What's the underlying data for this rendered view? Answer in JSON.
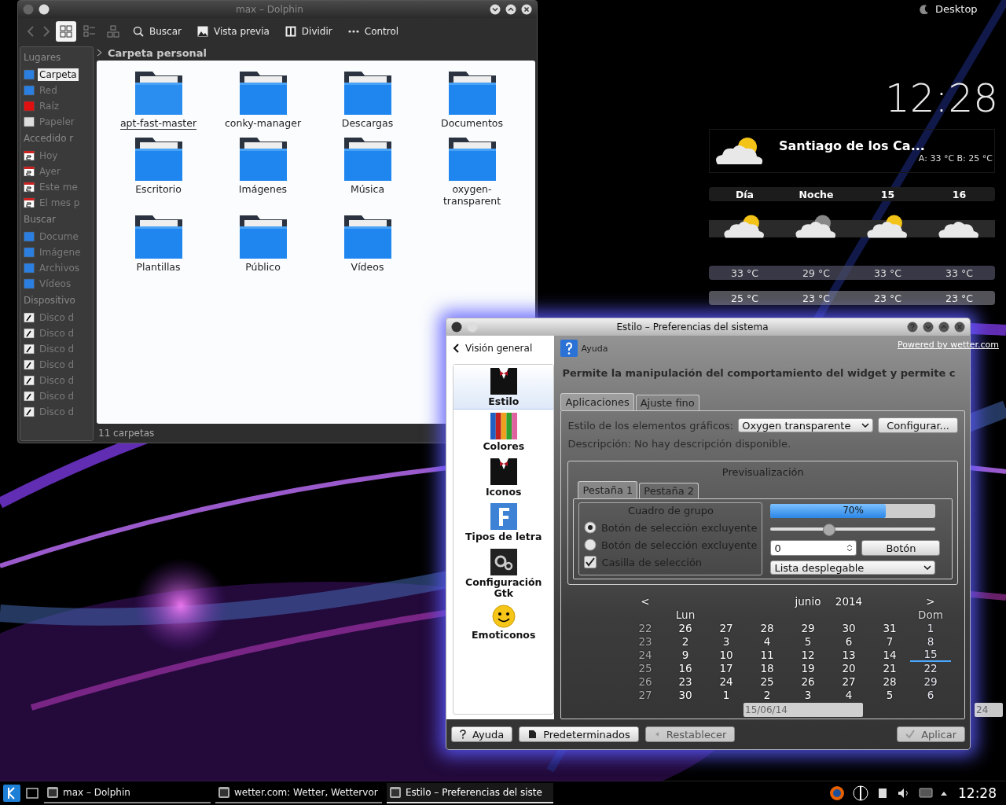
{
  "activity": {
    "label": "Desktop"
  },
  "clock": {
    "time": "12:28"
  },
  "weather": {
    "location": "Santiago de los Ca...",
    "summary": "A: 33 °C B: 25 °C",
    "columns": [
      {
        "label": "Día",
        "kind": "sun",
        "high": "33 °C",
        "low": "25 °C"
      },
      {
        "label": "Noche",
        "kind": "moon",
        "high": "29 °C",
        "low": "23 °C"
      },
      {
        "label": "15",
        "kind": "sun",
        "high": "33 °C",
        "low": "23 °C"
      },
      {
        "label": "16",
        "kind": "cloud",
        "high": "33 °C",
        "low": "23 °C"
      }
    ],
    "credit": "Powered by wetter.com"
  },
  "dolphin": {
    "title": "max – Dolphin",
    "view_modes": [
      {
        "selected": true
      },
      {
        "selected": false
      },
      {
        "selected": false
      }
    ],
    "actions": [
      {
        "kind": "search",
        "label": "Buscar"
      },
      {
        "kind": "preview",
        "label": "Vista previa"
      },
      {
        "kind": "split",
        "label": "Dividir"
      },
      {
        "kind": "menu",
        "label": "Control"
      }
    ],
    "places": [
      {
        "heading": "Lugares",
        "items": [
          {
            "kind": "home",
            "label": "Carpeta",
            "selected": true
          },
          {
            "kind": "network",
            "label": "Red",
            "selected": false
          },
          {
            "kind": "root",
            "label": "Raíz",
            "selected": false
          },
          {
            "kind": "trash",
            "label": "Papeler",
            "selected": false
          }
        ]
      },
      {
        "heading": "Accedido r",
        "items": [
          {
            "kind": "calendar",
            "label": "Hoy",
            "selected": false
          },
          {
            "kind": "calendar",
            "label": "Ayer",
            "selected": false
          },
          {
            "kind": "calendar",
            "label": "Este me",
            "selected": false
          },
          {
            "kind": "calendar",
            "label": "El mes p",
            "selected": false
          }
        ]
      },
      {
        "heading": "Buscar",
        "items": [
          {
            "kind": "document",
            "label": "Docume",
            "selected": false
          },
          {
            "kind": "image",
            "label": "Imágene",
            "selected": false
          },
          {
            "kind": "music",
            "label": "Archivos",
            "selected": false
          },
          {
            "kind": "video",
            "label": "Vídeos",
            "selected": false
          }
        ]
      },
      {
        "heading": "Dispositivo",
        "items": [
          {
            "kind": "disk",
            "label": "Disco d",
            "selected": false
          },
          {
            "kind": "disk",
            "label": "Disco d",
            "selected": false
          },
          {
            "kind": "disk",
            "label": "Disco d",
            "selected": false
          },
          {
            "kind": "disk",
            "label": "Disco d",
            "selected": false
          },
          {
            "kind": "disk",
            "label": "Disco d",
            "selected": false
          },
          {
            "kind": "disk",
            "label": "Disco d",
            "selected": false
          },
          {
            "kind": "disk",
            "label": "Disco d",
            "selected": false
          }
        ]
      }
    ],
    "breadcrumb": "Carpeta personal",
    "folders": [
      {
        "name": "apt-fast-master",
        "selected": true
      },
      {
        "name": "conky-manager",
        "selected": false
      },
      {
        "name": "Descargas",
        "selected": false
      },
      {
        "name": "Documentos",
        "selected": false
      },
      {
        "name": "Escritorio",
        "selected": false
      },
      {
        "name": "Imágenes",
        "selected": false
      },
      {
        "name": "Música",
        "selected": false
      },
      {
        "name": "oxygen-transparent",
        "selected": false
      },
      {
        "name": "Plantillas",
        "selected": false
      },
      {
        "name": "Público",
        "selected": false
      },
      {
        "name": "Vídeos",
        "selected": false
      }
    ],
    "status": "11 carpetas"
  },
  "settings": {
    "title": "Estilo – Preferencias del sistema",
    "back": "Visión general",
    "help": "Ayuda",
    "categories": [
      {
        "kind": "style",
        "label": "Estilo",
        "selected": true
      },
      {
        "kind": "colors",
        "label": "Colores",
        "selected": false
      },
      {
        "kind": "style",
        "label": "Iconos",
        "selected": false
      },
      {
        "kind": "fonts",
        "label": "Tipos de letra",
        "selected": false
      },
      {
        "kind": "gtk",
        "label": "Configuración Gtk",
        "selected": false
      },
      {
        "kind": "smiley",
        "label": "Emoticonos",
        "selected": false
      }
    ],
    "description": "Permite la manipulación del comportamiento del widget y permite c",
    "tabs": [
      {
        "label": "Aplicaciones",
        "selected": true
      },
      {
        "label": "Ajuste fino",
        "selected": false
      }
    ],
    "style_label": "Estilo de los elementos gráficos:",
    "style_value": "Oxygen transparente",
    "configure": "Configurar...",
    "style_description": "Descripción: No hay descripción disponible.",
    "preview": {
      "title": "Previsualización",
      "tabs": [
        {
          "label": "Pestaña 1",
          "selected": true
        },
        {
          "label": "Pestaña 2",
          "selected": false
        }
      ],
      "group_title": "Cuadro de grupo",
      "radios": [
        {
          "label": "Botón de selección excluyente",
          "selected": true
        },
        {
          "label": "Botón de selección excluyente",
          "selected": false
        }
      ],
      "checkbox": {
        "label": "Casilla de selección",
        "checked": true
      },
      "progress": {
        "level": 0.7,
        "reading": "70%"
      },
      "slider": {
        "level": 0.35
      },
      "spin": "0",
      "button": "Botón",
      "combo": "Lista desplegable"
    },
    "buttons": [
      {
        "kind": "help",
        "label": "Ayuda",
        "disabled": false
      },
      {
        "kind": "defaults",
        "label": "Predeterminados",
        "disabled": false
      },
      {
        "kind": "reset",
        "label": "Restablecer",
        "disabled": true
      },
      {
        "kind": "apply",
        "label": "Aplicar",
        "disabled": true
      }
    ]
  },
  "calendar": {
    "prev": "<",
    "month": "junio",
    "year": "2014",
    "next": ">",
    "first_day": "Lun",
    "last_day": "Dom",
    "date_field": "15/06/14",
    "week_field": "24",
    "weeks": [
      {
        "number": "22",
        "days": [
          {
            "label": "26",
            "today": false
          },
          {
            "label": "27",
            "today": false
          },
          {
            "label": "28",
            "today": false
          },
          {
            "label": "29",
            "today": false
          },
          {
            "label": "30",
            "today": false
          },
          {
            "label": "31",
            "today": false
          },
          {
            "label": "1",
            "today": false
          }
        ]
      },
      {
        "number": "23",
        "days": [
          {
            "label": "2",
            "today": false
          },
          {
            "label": "3",
            "today": false
          },
          {
            "label": "4",
            "today": false
          },
          {
            "label": "5",
            "today": false
          },
          {
            "label": "6",
            "today": false
          },
          {
            "label": "7",
            "today": false
          },
          {
            "label": "8",
            "today": false
          }
        ]
      },
      {
        "number": "24",
        "days": [
          {
            "label": "9",
            "today": false
          },
          {
            "label": "10",
            "today": false
          },
          {
            "label": "11",
            "today": false
          },
          {
            "label": "12",
            "today": false
          },
          {
            "label": "13",
            "today": false
          },
          {
            "label": "14",
            "today": false
          },
          {
            "label": "15",
            "today": true
          }
        ]
      },
      {
        "number": "25",
        "days": [
          {
            "label": "16",
            "today": false
          },
          {
            "label": "17",
            "today": false
          },
          {
            "label": "18",
            "today": false
          },
          {
            "label": "19",
            "today": false
          },
          {
            "label": "20",
            "today": false
          },
          {
            "label": "21",
            "today": false
          },
          {
            "label": "22",
            "today": false
          }
        ]
      },
      {
        "number": "26",
        "days": [
          {
            "label": "23",
            "today": false
          },
          {
            "label": "24",
            "today": false
          },
          {
            "label": "25",
            "today": false
          },
          {
            "label": "26",
            "today": false
          },
          {
            "label": "27",
            "today": false
          },
          {
            "label": "28",
            "today": false
          },
          {
            "label": "29",
            "today": false
          }
        ]
      },
      {
        "number": "27",
        "days": [
          {
            "label": "30",
            "today": false
          },
          {
            "label": "1",
            "today": false
          },
          {
            "label": "2",
            "today": false
          },
          {
            "label": "3",
            "today": false
          },
          {
            "label": "4",
            "today": false
          },
          {
            "label": "5",
            "today": false
          },
          {
            "label": "6",
            "today": false
          }
        ]
      }
    ]
  },
  "taskbar": {
    "tasks": [
      {
        "label": "max – Dolphin",
        "selected": false
      },
      {
        "label": "wetter.com: Wetter, Wettervor",
        "selected": false
      },
      {
        "label": "Estilo – Preferencias del siste",
        "selected": true
      }
    ],
    "time": "12:28"
  }
}
